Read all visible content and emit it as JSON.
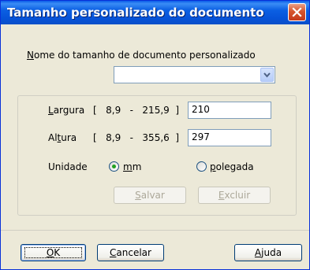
{
  "window": {
    "title": "Tamanho personalizado do documento",
    "close_icon": "close-icon"
  },
  "custom_name": {
    "label_first": "N",
    "label_rest": "ome do tamanho de documento personalizado",
    "value": ""
  },
  "dimensions": {
    "width": {
      "label_first": "L",
      "label_rest": "argura",
      "range": "[   8,9   -   215,9  ]",
      "value": "210"
    },
    "height": {
      "label_pre": "Al",
      "label_key": "t",
      "label_post": "ura",
      "range": "[   8,9   -   355,6  ]",
      "value": "297"
    }
  },
  "unit": {
    "label": "Unidade",
    "options": [
      {
        "key": "m",
        "rest": "m",
        "selected": true
      },
      {
        "key": "p",
        "rest": "olegada",
        "selected": false
      }
    ]
  },
  "actions": {
    "save": {
      "key": "S",
      "rest": "alvar"
    },
    "delete": {
      "key": "E",
      "rest": "xcluir"
    }
  },
  "footer": {
    "ok": {
      "key": "O",
      "rest": "K"
    },
    "cancel": {
      "key": "C",
      "rest": "ancelar"
    },
    "help": {
      "key": "A",
      "rest": "juda"
    }
  },
  "colors": {
    "titlebar": "#0653D8",
    "face": "#ECE9D8",
    "radio_dot": "#21A121",
    "close": "#D6542C"
  }
}
